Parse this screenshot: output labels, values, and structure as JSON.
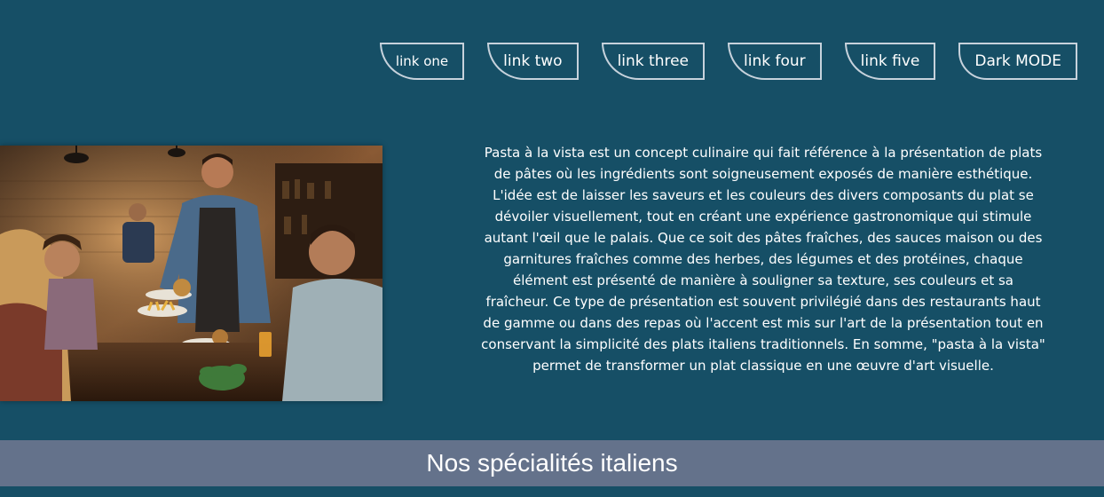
{
  "nav": {
    "links": [
      {
        "label": "link one"
      },
      {
        "label": "link two"
      },
      {
        "label": "link three"
      },
      {
        "label": "link four"
      },
      {
        "label": "link five"
      },
      {
        "label": "Dark MODE"
      }
    ]
  },
  "hero": {
    "image_icon": "restaurant-scene-image",
    "description": "Pasta à la vista est un concept culinaire qui fait référence à la présentation de plats de pâtes où les ingrédients sont soigneusement exposés de manière esthétique. L'idée est de laisser les saveurs et les couleurs des divers composants du plat se dévoiler visuellement, tout en créant une expérience gastronomique qui stimule autant l'œil que le palais. Que ce soit des pâtes fraîches, des sauces maison ou des garnitures fraîches comme des herbes, des légumes et des protéines, chaque élément est présenté de manière à souligner sa texture, ses couleurs et sa fraîcheur. Ce type de présentation est souvent privilégié dans des restaurants haut de gamme ou dans des repas où l'accent est mis sur l'art de la présentation tout en conservant la simplicité des plats italiens traditionnels. En somme, \"pasta à la vista\" permet de transformer un plat classique en une œuvre d'art visuelle."
  },
  "section": {
    "title": "Nos spécialités italiens"
  },
  "colors": {
    "background": "#164f66",
    "section_bar": "#64728b",
    "nav_border": "#c7d2dc",
    "text": "#ffffff"
  }
}
